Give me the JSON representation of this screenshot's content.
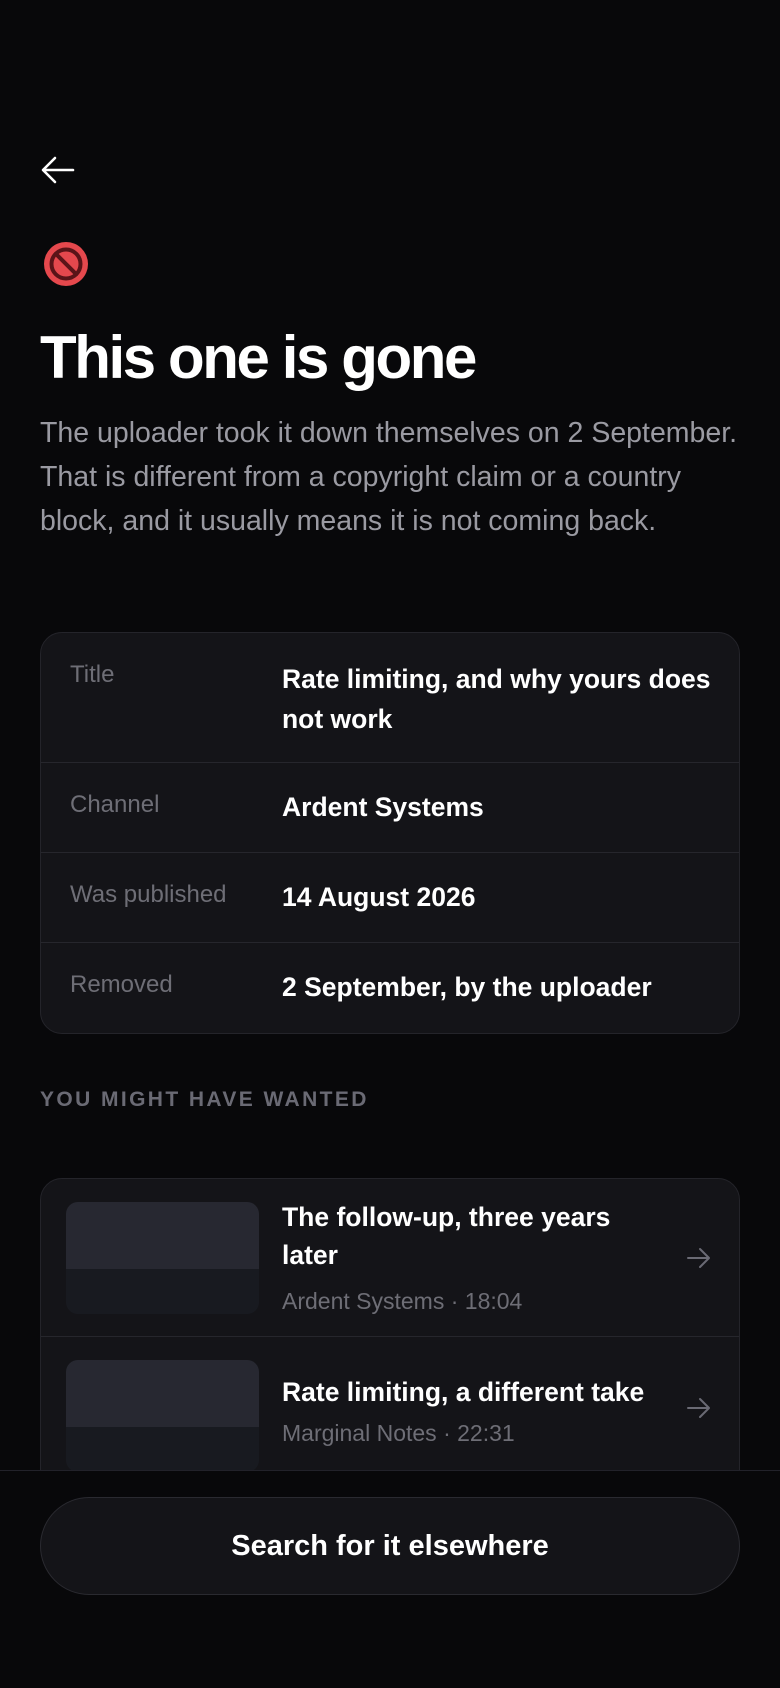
{
  "nav": {
    "back_icon": "arrow-left-icon"
  },
  "status": {
    "icon": "prohibited-icon",
    "color": "#e5484d"
  },
  "headline": "This one is gone",
  "description": "The uploader took it down themselves on 2 September. That is different from a copyright claim or a country block, and it usually means it is not coming back.",
  "details": [
    {
      "label": "Title",
      "value": "Rate limiting, and why yours does not work"
    },
    {
      "label": "Channel",
      "value": "Ardent Systems"
    },
    {
      "label": "Was published",
      "value": "14 August 2026"
    },
    {
      "label": "Removed",
      "value": "2 September, by the uploader"
    }
  ],
  "related_section": {
    "title": "YOU MIGHT HAVE WANTED",
    "items": [
      {
        "title": "The follow-up, three years later",
        "meta": "Ardent Systems · 18:04",
        "icon": "arrow-right-icon"
      },
      {
        "title": "Rate limiting, a different take",
        "meta": "Marginal Notes · 22:31",
        "icon": "arrow-right-icon"
      }
    ]
  },
  "footer": {
    "search_label": "Search for it elsewhere"
  }
}
